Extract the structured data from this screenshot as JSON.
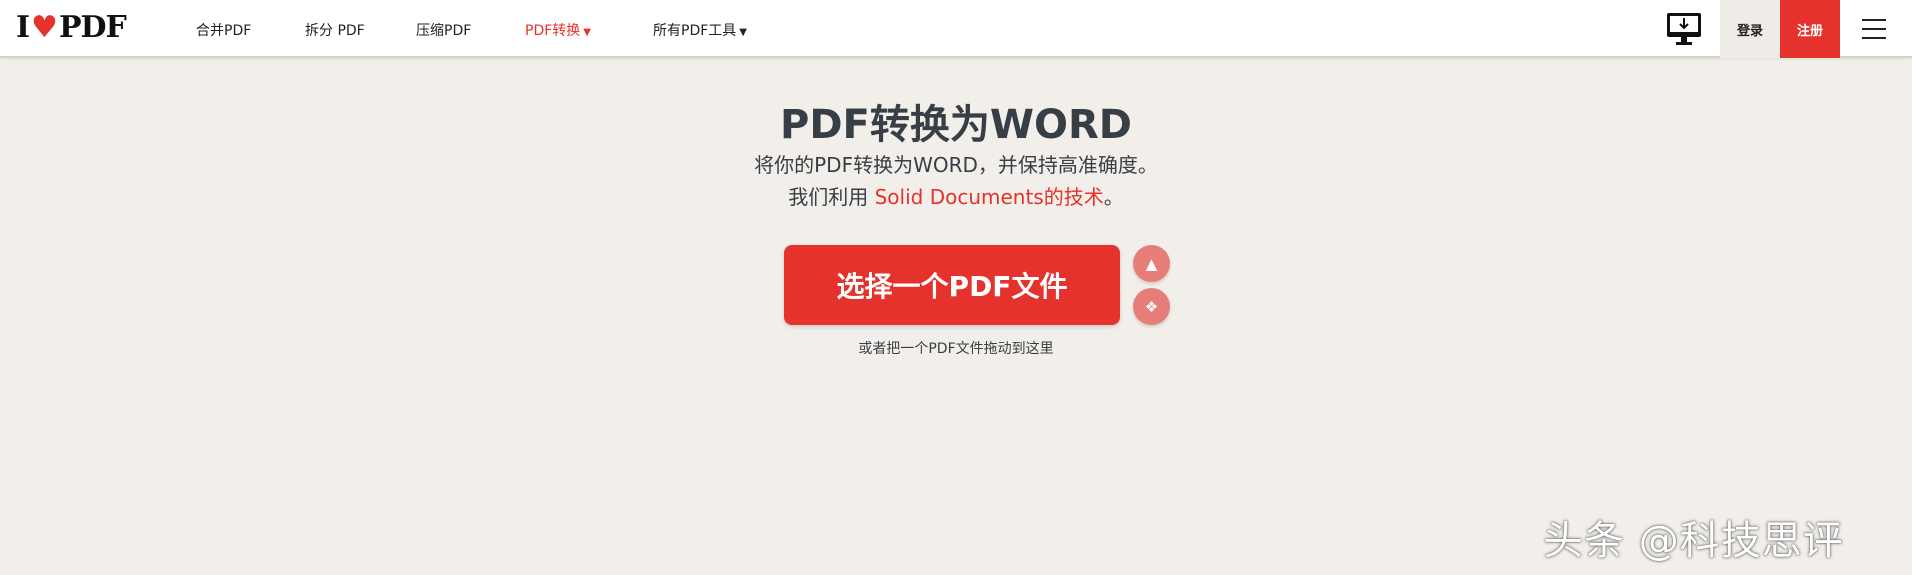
{
  "nav": {
    "logo": "I♥PDF",
    "items": [
      {
        "label": "合并PDF"
      },
      {
        "label": "拆分 PDF"
      },
      {
        "label": "压缩PDF"
      },
      {
        "label": "PDF转换"
      },
      {
        "label": "所有PDF工具"
      }
    ],
    "login": "登录",
    "register": "注册"
  },
  "main": {
    "title": "PDF转换为WORD",
    "subtitle1": "将你的PDF转换为WORD，并保持高准确度。",
    "subtitle2_prefix": "我们利用 ",
    "subtitle2_link": "Solid Documents的技术",
    "subtitle2_suffix": "。",
    "select_button": "选择一个PDF文件",
    "drop_hint": "或者把一个PDF文件拖动到这里"
  },
  "watermark": "头条 @科技思评",
  "colors": {
    "accent": "#e5322d",
    "background": "#f2efea"
  }
}
